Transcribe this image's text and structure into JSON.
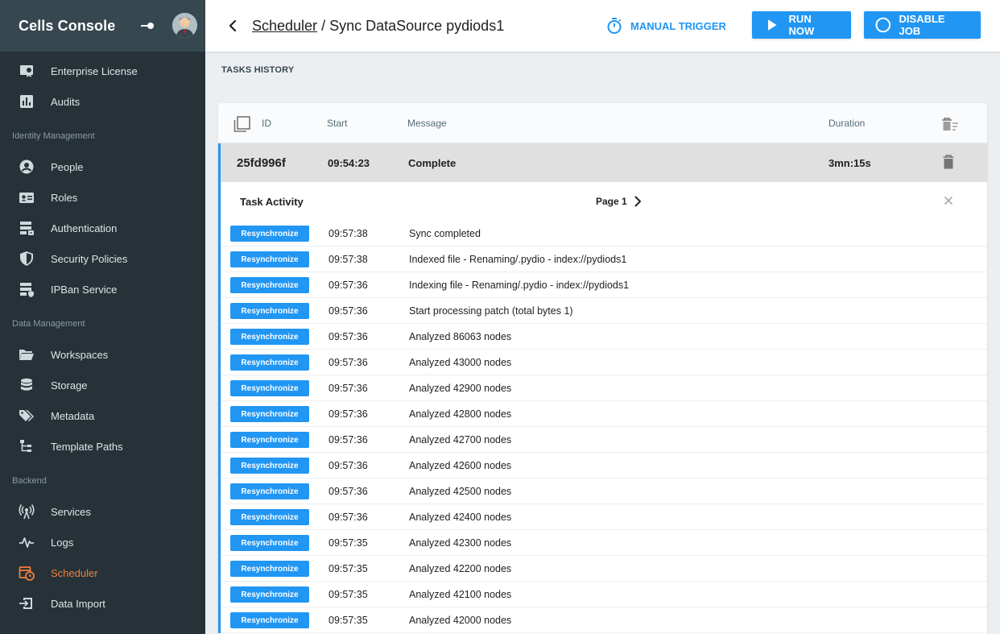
{
  "sidebar": {
    "brand": "Cells Console",
    "items": [
      {
        "id": "enterprise-license",
        "label": "Enterprise License",
        "icon": "certificate-icon",
        "active": false
      },
      {
        "id": "audits",
        "label": "Audits",
        "icon": "chart-icon",
        "active": false
      },
      {
        "section": "Identity Management"
      },
      {
        "id": "people",
        "label": "People",
        "icon": "account-icon",
        "active": false
      },
      {
        "id": "roles",
        "label": "Roles",
        "icon": "id-card-icon",
        "active": false
      },
      {
        "id": "authentication",
        "label": "Authentication",
        "icon": "server-lock-icon",
        "active": false
      },
      {
        "id": "security-policies",
        "label": "Security Policies",
        "icon": "shield-icon",
        "active": false
      },
      {
        "id": "ipban-service",
        "label": "IPBan Service",
        "icon": "server-shield-icon",
        "active": false
      },
      {
        "section": "Data Management"
      },
      {
        "id": "workspaces",
        "label": "Workspaces",
        "icon": "folder-open-icon",
        "active": false
      },
      {
        "id": "storage",
        "label": "Storage",
        "icon": "database-icon",
        "active": false
      },
      {
        "id": "metadata",
        "label": "Metadata",
        "icon": "tags-icon",
        "active": false
      },
      {
        "id": "template-paths",
        "label": "Template Paths",
        "icon": "file-tree-icon",
        "active": false
      },
      {
        "section": "Backend"
      },
      {
        "id": "services",
        "label": "Services",
        "icon": "access-point-icon",
        "active": false
      },
      {
        "id": "logs",
        "label": "Logs",
        "icon": "pulse-icon",
        "active": false
      },
      {
        "id": "scheduler",
        "label": "Scheduler",
        "icon": "calendar-clock-icon",
        "active": true
      },
      {
        "id": "data-import",
        "label": "Data Import",
        "icon": "import-icon",
        "active": false
      }
    ],
    "colors": {
      "background": "#263238",
      "header": "#37474F",
      "active": "#F57C3B"
    }
  },
  "header": {
    "breadcrumb_link": "Scheduler",
    "breadcrumb_sep": " / ",
    "breadcrumb_title": "Sync DataSource pydiods1",
    "manual_trigger_label": "MANUAL TRIGGER",
    "run_now_label": "RUN NOW",
    "disable_job_label": "DISABLE JOB",
    "accent": "#2196F3"
  },
  "tasks": {
    "section_title": "TASKS HISTORY",
    "columns": {
      "id": "ID",
      "start": "Start",
      "message": "Message",
      "duration": "Duration"
    },
    "row": {
      "id": "25fd996f",
      "start": "09:54:23",
      "message": "Complete",
      "duration": "3mn:15s"
    }
  },
  "activity": {
    "title": "Task Activity",
    "page_label": "Page 1",
    "badge_label": "Resynchronize",
    "rows": [
      {
        "time": "09:57:38",
        "message": "Sync completed"
      },
      {
        "time": "09:57:38",
        "message": "Indexed file - Renaming/.pydio - index://pydiods1"
      },
      {
        "time": "09:57:36",
        "message": "Indexing file - Renaming/.pydio - index://pydiods1"
      },
      {
        "time": "09:57:36",
        "message": "Start processing patch (total bytes 1)"
      },
      {
        "time": "09:57:36",
        "message": "Analyzed 86063 nodes"
      },
      {
        "time": "09:57:36",
        "message": "Analyzed 43000 nodes"
      },
      {
        "time": "09:57:36",
        "message": "Analyzed 42900 nodes"
      },
      {
        "time": "09:57:36",
        "message": "Analyzed 42800 nodes"
      },
      {
        "time": "09:57:36",
        "message": "Analyzed 42700 nodes"
      },
      {
        "time": "09:57:36",
        "message": "Analyzed 42600 nodes"
      },
      {
        "time": "09:57:36",
        "message": "Analyzed 42500 nodes"
      },
      {
        "time": "09:57:36",
        "message": "Analyzed 42400 nodes"
      },
      {
        "time": "09:57:35",
        "message": "Analyzed 42300 nodes"
      },
      {
        "time": "09:57:35",
        "message": "Analyzed 42200 nodes"
      },
      {
        "time": "09:57:35",
        "message": "Analyzed 42100 nodes"
      },
      {
        "time": "09:57:35",
        "message": "Analyzed 42000 nodes"
      }
    ]
  }
}
